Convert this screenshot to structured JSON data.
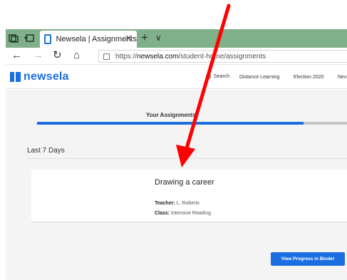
{
  "browser": {
    "tab_title": "Newsela | Assignments",
    "tab_close": "✕",
    "new_tab": "+",
    "tab_list": "∨",
    "url_prefix": "https://",
    "url_domain": "newsela.com",
    "url_path": "/student-home/assignments",
    "nav": {
      "back": "←",
      "forward": "→",
      "refresh": "↻",
      "home": "⌂"
    }
  },
  "site": {
    "logo_text": "newsela",
    "search_label": "Search",
    "nav_links": [
      "Distance Learning",
      "Election 2020",
      "Nev"
    ]
  },
  "main": {
    "tab_label": "Your Assignments",
    "progress_fraction": 0.86,
    "section_title": "Last 7 Days",
    "card": {
      "title": "Drawing a career",
      "teacher_label": "Teacher:",
      "teacher_value": "L. Roberts",
      "class_label": "Class:",
      "class_value": "Intensive Reading"
    },
    "binder_button": "View Progress in Binder"
  },
  "colors": {
    "tabbar": "#7fb08a",
    "brand": "#1b6fe0",
    "annotation_arrow": "#ff0000"
  },
  "icons": [
    "window-icon",
    "tab-actions-icon",
    "newsela-favicon",
    "lock-icon",
    "search-icon",
    "newsela-logo-icon",
    "annotation-arrow"
  ]
}
